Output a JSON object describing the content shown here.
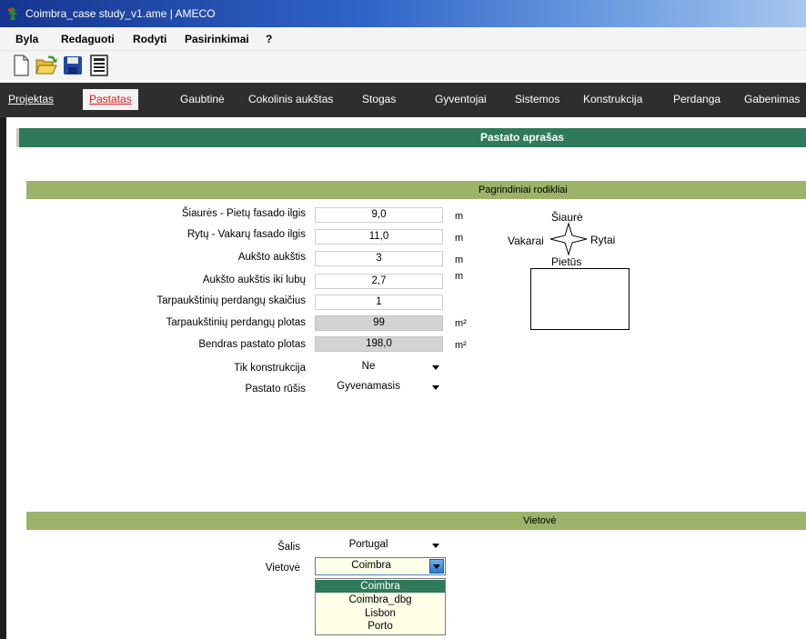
{
  "window": {
    "title": "Coimbra_case study_v1.ame | AMECO"
  },
  "menu": [
    "Byla",
    "Redaguoti",
    "Rodyti",
    "Pasirinkimai",
    "?"
  ],
  "toolbar": [
    "new-file-icon",
    "open-folder-icon",
    "save-icon",
    "report-icon"
  ],
  "tabs": [
    "Projektas",
    "Pastatas",
    "Gaubtinė",
    "Cokolinis aukštas",
    "Stogas",
    "Gyventojai",
    "Sistemos",
    "Konstrukcija",
    "Perdanga",
    "Gabenimas"
  ],
  "active_tab": "Pastatas",
  "page_title": "Pastato aprašas",
  "main_section": {
    "title": "Pagrindiniai rodikliai",
    "fields": [
      {
        "label": "Šiaurės - Pietų fasado ilgis",
        "value": "9,0",
        "unit": "m",
        "readonly": false
      },
      {
        "label": "Rytų - Vakarų fasado ilgis",
        "value": "11,0",
        "unit": "m",
        "readonly": false
      },
      {
        "label": "Aukšto aukštis",
        "value": "3",
        "unit": "m",
        "readonly": false
      },
      {
        "label": "Aukšto aukštis iki lubų",
        "value": "2,7",
        "unit": "m",
        "readonly": false
      },
      {
        "label": "Tarpaukštinių perdangų skaičius",
        "value": "1",
        "unit": "",
        "readonly": false
      },
      {
        "label": "Tarpaukštinių perdangų plotas",
        "value": "99",
        "unit": "m²",
        "readonly": true
      },
      {
        "label": "Bendras pastato plotas",
        "value": "198,0",
        "unit": "m²",
        "readonly": true
      }
    ],
    "selects": [
      {
        "label": "Tik konstrukcija",
        "value": "Ne"
      },
      {
        "label": "Pastato rūšis",
        "value": "Gyvenamasis"
      }
    ],
    "compass": {
      "north": "Šiaurė",
      "west": "Vakarai",
      "east": "Rytai",
      "south": "Pietūs"
    }
  },
  "location_section": {
    "title": "Vietovė",
    "country": {
      "label": "Šalis",
      "value": "Portugal"
    },
    "location": {
      "label": "Vietovė",
      "value": "Coimbra",
      "options": [
        "Coimbra",
        "Coimbra_dbg",
        "Lisbon",
        "Porto"
      ],
      "selected_index": 0
    }
  },
  "colors": {
    "accent_green": "#2e7a5a",
    "section_green": "#9cb46a",
    "active_tab_text": "#e11b1b"
  }
}
